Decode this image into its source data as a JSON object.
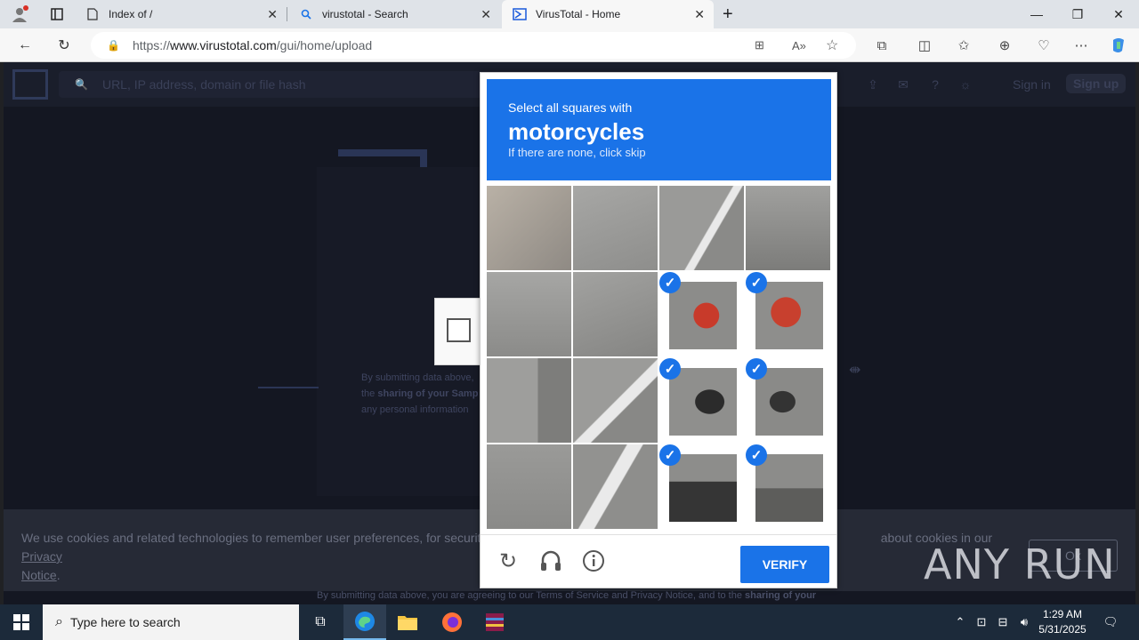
{
  "browser": {
    "tabs": [
      {
        "title": "Index of /",
        "icon": "file-icon"
      },
      {
        "title": "virustotal - Search",
        "icon": "search-icon"
      },
      {
        "title": "VirusTotal - Home",
        "icon": "virustotal-icon",
        "active": true
      }
    ],
    "url_host_prefix": "https://",
    "url_host": "www.virustotal.com",
    "url_path": "/gui/home/upload"
  },
  "virustotal": {
    "search_placeholder": "URL, IP address, domain or file hash",
    "sign_in": "Sign in",
    "sign_up": "Sign up",
    "fine_print_1": "By submitting data above,",
    "fine_print_2a": "the ",
    "fine_print_2b": "sharing of your Samp",
    "fine_print_3": "any personal information",
    "bottom_fine_a": "By submitting data above, you are agreeing to our ",
    "bottom_fine_tos": "Terms of Service",
    "bottom_fine_and": " and ",
    "bottom_fine_privacy": "Privacy Notice",
    "bottom_fine_b": ", and to the ",
    "bottom_fine_sharing": "sharing of your"
  },
  "cookie_banner": {
    "text_a": "We use cookies and related technologies to remember user preferences, for security, to",
    "text_b": " about cookies in our ",
    "privacy_link_a": "Privacy",
    "privacy_link_b": "Notice",
    "period": ".",
    "ok_label": "Ok"
  },
  "captcha": {
    "instruction": "Select all squares with",
    "target": "motorcycles",
    "hint": "If there are none, click skip",
    "verify_label": "VERIFY",
    "tiles_selected": [
      false,
      false,
      false,
      false,
      false,
      false,
      true,
      true,
      false,
      false,
      true,
      true,
      false,
      false,
      true,
      true
    ]
  },
  "watermark": "ANY RUN",
  "taskbar": {
    "search_placeholder": "Type here to search",
    "time": "1:29 AM",
    "date": "5/31/2025"
  },
  "colors": {
    "captcha_blue": "#1a73e8",
    "vt_bg": "#141722"
  }
}
